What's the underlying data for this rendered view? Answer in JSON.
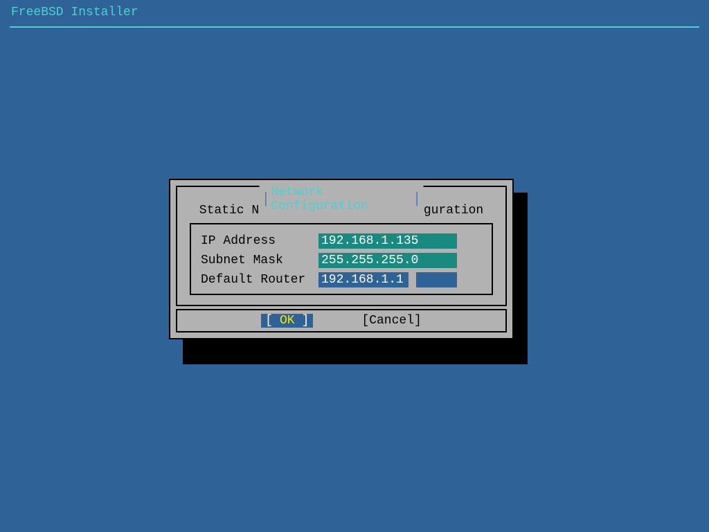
{
  "header": {
    "title": "FreeBSD Installer"
  },
  "dialog": {
    "title": "Network Configuration",
    "subtitle": "Static Network Interface Configuration",
    "fields": [
      {
        "label": "IP Address",
        "value": "192.168.1.135",
        "style": "teal"
      },
      {
        "label": "Subnet Mask",
        "value": "255.255.255.0",
        "style": "teal"
      },
      {
        "label": "Default Router",
        "value": "192.168.1.1",
        "style": "blue",
        "focused": true
      }
    ],
    "buttons": {
      "ok": "OK",
      "cancel": "Cancel"
    }
  }
}
